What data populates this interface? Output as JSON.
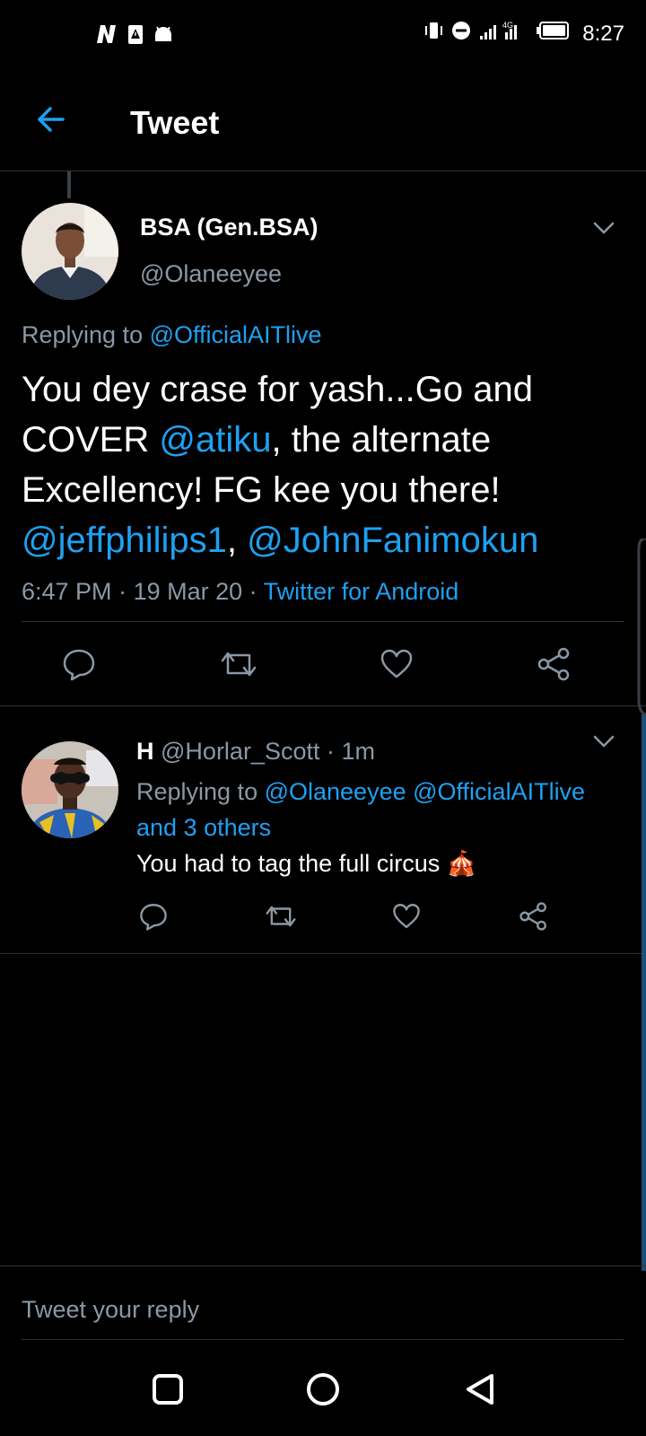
{
  "status_bar": {
    "time": "8:27",
    "network": "4G",
    "icons": [
      "netflix-icon",
      "alert-icon",
      "android-icon",
      "vibrate-icon",
      "dnd-icon",
      "signal-icon",
      "battery-icon"
    ]
  },
  "header": {
    "title": "Tweet"
  },
  "main_tweet": {
    "display_name": "BSA (Gen.BSA)",
    "handle": "@Olaneeyee",
    "replying_prefix": "Replying to ",
    "replying_to": "@OfficialAITlive",
    "body": {
      "t1": "You dey crase for yash...Go and COVER ",
      "m1": "@atiku",
      "t2": ", the alternate Excellency! FG kee you there! ",
      "m2": "@jeffphilips1",
      "t3": ", ",
      "m3": "@JohnFanimokun"
    },
    "time": "6:47 PM",
    "sep": " · ",
    "date": "19 Mar 20",
    "source": "Twitter for Android"
  },
  "reply": {
    "display_name": "H",
    "handle": "@Horlar_Scott",
    "time": "1m",
    "sep": " · ",
    "replying_prefix": "Replying to ",
    "replying_to_1": "@Olaneeyee",
    "replying_to_2": "@OfficialAITlive",
    "replying_others": "and 3 others",
    "text": "You had to tag the full circus",
    "emoji": "🎪"
  },
  "composer": {
    "placeholder": "Tweet your reply"
  },
  "colors": {
    "accent": "#1da1f2",
    "muted": "#8b98a5",
    "background": "#000000"
  }
}
